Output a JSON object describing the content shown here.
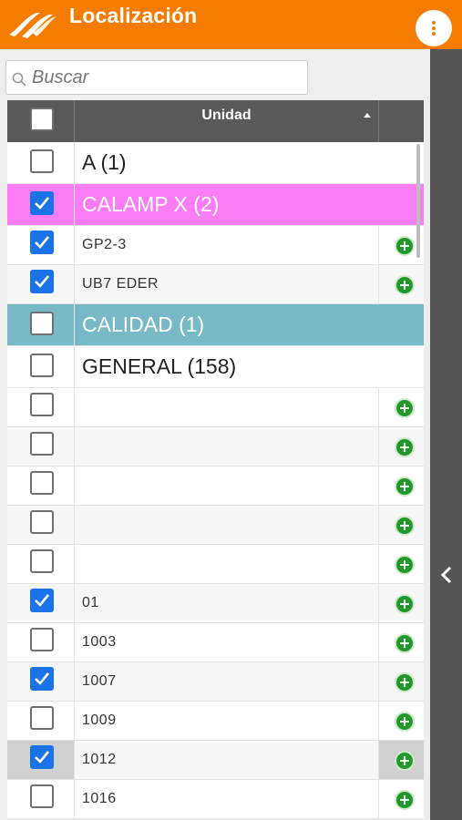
{
  "header": {
    "title": "Localización",
    "bg_color": "#f57c00"
  },
  "search": {
    "placeholder": "Buscar",
    "value": ""
  },
  "table": {
    "column_header": "Unidad",
    "sort": "ascending",
    "rows": [
      {
        "type": "group",
        "label": "A (1)",
        "checked": false,
        "color": "#ffffff"
      },
      {
        "type": "group",
        "label": "CALAMP X (2)",
        "checked": true,
        "color": "#fb7df6"
      },
      {
        "type": "item",
        "label": "GP2-3",
        "checked": true
      },
      {
        "type": "item",
        "label": "UB7 EDER",
        "checked": true
      },
      {
        "type": "group",
        "label": "CALIDAD (1)",
        "checked": false,
        "color": "#77b9c6"
      },
      {
        "type": "group",
        "label": "GENERAL (158)",
        "checked": false,
        "color": "#ffffff"
      },
      {
        "type": "item",
        "label": "",
        "checked": false
      },
      {
        "type": "item",
        "label": "",
        "checked": false
      },
      {
        "type": "item",
        "label": "",
        "checked": false
      },
      {
        "type": "item",
        "label": "",
        "checked": false
      },
      {
        "type": "item",
        "label": "",
        "checked": false
      },
      {
        "type": "item",
        "label": "01",
        "checked": true
      },
      {
        "type": "item",
        "label": "1003",
        "checked": false
      },
      {
        "type": "item",
        "label": "1007",
        "checked": true
      },
      {
        "type": "item",
        "label": "1009",
        "checked": false
      },
      {
        "type": "item",
        "label": "1012",
        "checked": true,
        "selected": true
      },
      {
        "type": "item",
        "label": "1016",
        "checked": false
      }
    ]
  },
  "icons": {
    "logo": "brand-logo-icon",
    "menu": "more-vertical-icon",
    "search": "search-icon",
    "sort": "sort-ascending-icon",
    "add": "add-circle-icon",
    "collapse": "chevron-left-icon"
  },
  "colors": {
    "accent": "#f57c00",
    "checkbox": "#1a73e8",
    "add": "#1f9a2a",
    "side_bar": "#555555"
  }
}
